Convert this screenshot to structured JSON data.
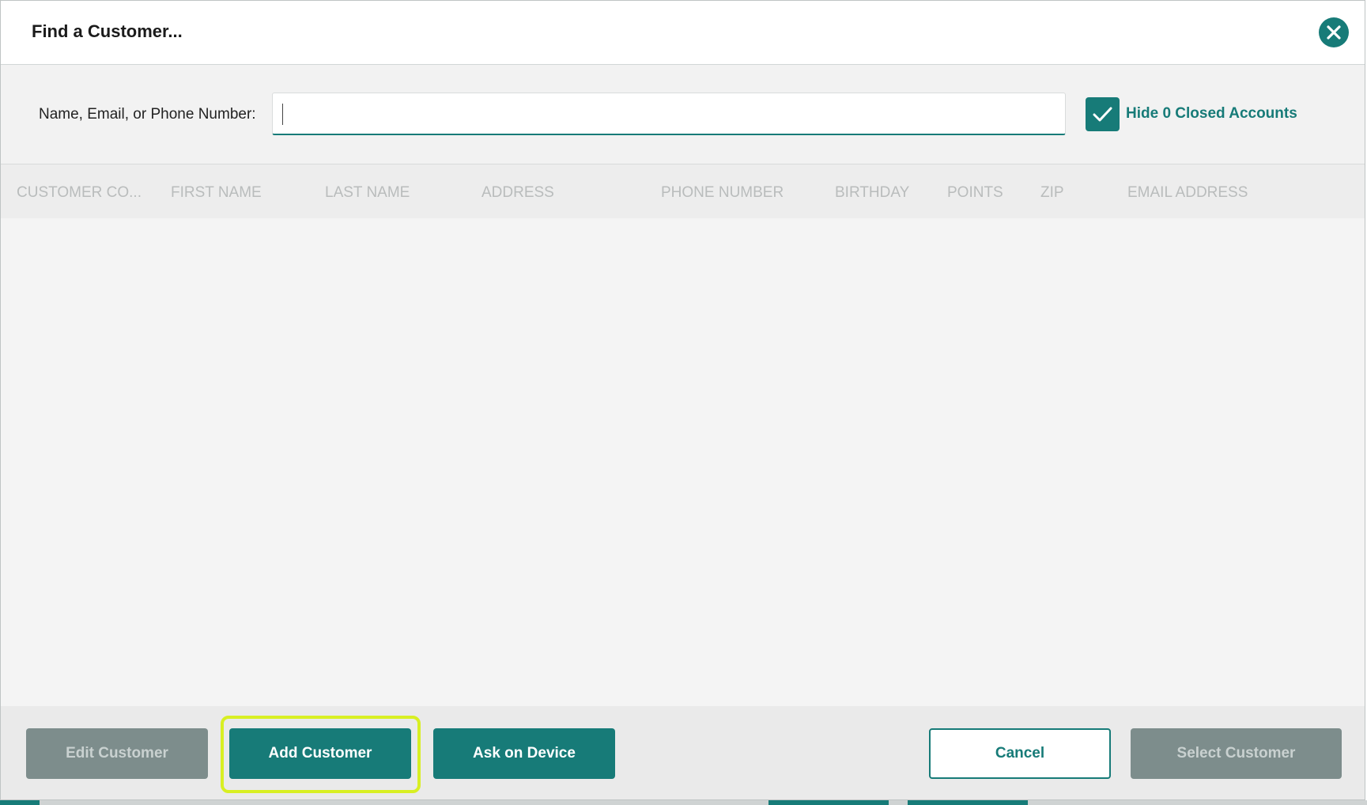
{
  "dialog": {
    "title": "Find a Customer..."
  },
  "search": {
    "label": "Name, Email, or Phone Number:",
    "value": "",
    "placeholder": "",
    "hide_closed_label": "Hide 0 Closed Accounts",
    "hide_closed_checked": true
  },
  "table": {
    "columns": [
      "CUSTOMER CO...",
      "FIRST NAME",
      "LAST NAME",
      "ADDRESS",
      "PHONE NUMBER",
      "BIRTHDAY",
      "POINTS",
      "ZIP",
      "EMAIL ADDRESS"
    ],
    "rows": []
  },
  "footer": {
    "edit_label": "Edit Customer",
    "add_label": "Add Customer",
    "ask_label": "Ask on Device",
    "cancel_label": "Cancel",
    "select_label": "Select Customer"
  },
  "colors": {
    "accent": "#177b78",
    "disabled_button": "#7d8d8c",
    "highlight": "#d8ef23"
  },
  "icons": {
    "close": "close-icon",
    "check": "checkmark-icon"
  }
}
